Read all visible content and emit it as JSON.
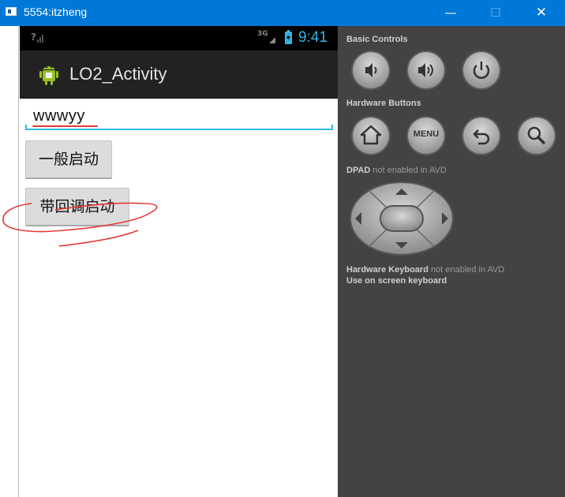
{
  "window": {
    "title": "5554:itzheng",
    "minimize_glyph": "—",
    "maximize_glyph": "☐",
    "close_glyph": "✕"
  },
  "statusbar": {
    "signal_left": "?",
    "network": "3G",
    "time": "9:41",
    "accent_color": "#33b5e5"
  },
  "actionbar": {
    "app_icon": "android-icon",
    "title": "LO2_Activity"
  },
  "edit_field": {
    "value": "wwwyy"
  },
  "buttons": {
    "normal_start": "一般启动",
    "start_with_callback": "带回调启动"
  },
  "panel": {
    "basic_controls": "Basic Controls",
    "hardware_buttons": "Hardware Buttons",
    "menu_label": "MENU",
    "dpad_label": "DPAD",
    "dpad_note": "not enabled in AVD",
    "keyboard_label": "Hardware Keyboard",
    "keyboard_note": "not enabled in AVD",
    "onscreen_keyboard": "Use on screen keyboard"
  },
  "icons": [
    "volume-down-icon",
    "volume-up-icon",
    "power-icon",
    "home-icon",
    "menu-icon",
    "back-icon",
    "search-icon",
    "dpad-icon"
  ],
  "annotation_color": "#e53935"
}
